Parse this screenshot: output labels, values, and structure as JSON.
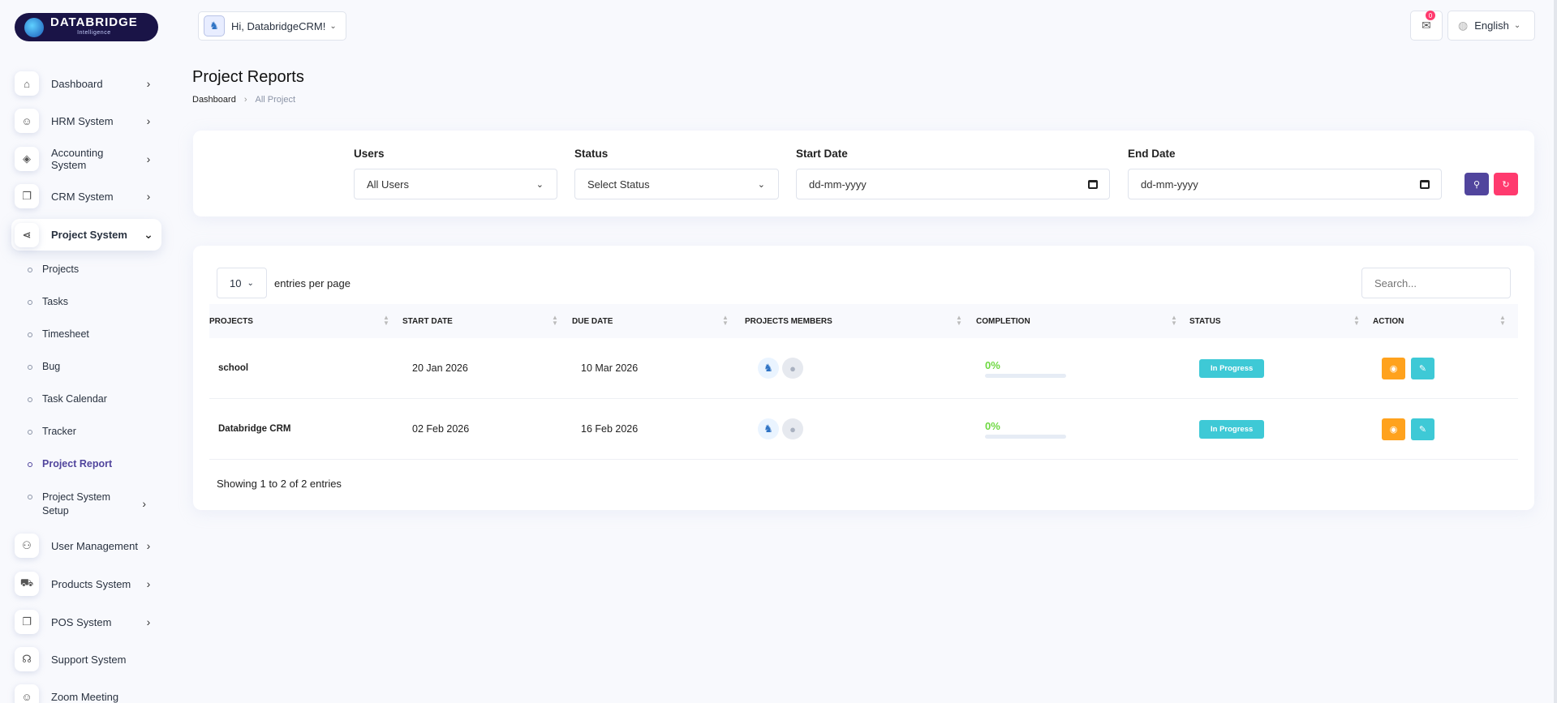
{
  "brand": {
    "logo_text": "DATABRIDGE",
    "logo_sub": "Intelligence"
  },
  "sidebar": {
    "items": [
      {
        "label": "Dashboard",
        "icon": "home-icon"
      },
      {
        "label": "HRM System",
        "icon": "user-icon"
      },
      {
        "label": "Accounting System",
        "icon": "box-icon"
      },
      {
        "label": "CRM System",
        "icon": "layers-icon"
      },
      {
        "label": "Project System",
        "icon": "share-icon"
      },
      {
        "label": "User Management",
        "icon": "users-icon"
      },
      {
        "label": "Products System",
        "icon": "cart-icon"
      },
      {
        "label": "POS System",
        "icon": "layers-icon"
      },
      {
        "label": "Support System",
        "icon": "headset-icon"
      },
      {
        "label": "Zoom Meeting",
        "icon": "user-video-icon"
      }
    ],
    "project_sub": [
      {
        "label": "Projects"
      },
      {
        "label": "Tasks"
      },
      {
        "label": "Timesheet"
      },
      {
        "label": "Bug"
      },
      {
        "label": "Task Calendar"
      },
      {
        "label": "Tracker"
      },
      {
        "label": "Project Report"
      },
      {
        "label": "Project System Setup"
      }
    ]
  },
  "header": {
    "greeting": "Hi, DatabridgeCRM!",
    "notification_count": "0",
    "language": "English"
  },
  "page": {
    "title": "Project Reports",
    "breadcrumb": [
      "Dashboard",
      "All Project"
    ]
  },
  "filters": {
    "users_label": "Users",
    "users_value": "All Users",
    "status_label": "Status",
    "status_value": "Select Status",
    "start_label": "Start Date",
    "start_placeholder": "dd-mm-yyyy",
    "end_label": "End Date",
    "end_placeholder": "dd-mm-yyyy"
  },
  "table": {
    "per_page": "10",
    "per_page_label": "entries per page",
    "search_placeholder": "Search...",
    "columns": [
      "Projects",
      "Start Date",
      "Due Date",
      "Projects Members",
      "Completion",
      "Status",
      "Action"
    ],
    "rows": [
      {
        "project": "school",
        "start": "20 Jan 2026",
        "due": "10 Mar 2026",
        "completion": "0%",
        "completion_value": 0,
        "status": "In Progress"
      },
      {
        "project": "Databridge CRM",
        "start": "02 Feb 2026",
        "due": "16 Feb 2026",
        "completion": "0%",
        "completion_value": 0,
        "status": "In Progress"
      }
    ],
    "footer": "Showing 1 to 2 of 2 entries"
  },
  "colors": {
    "primary": "#51459d",
    "danger": "#ff3a6e",
    "warning": "#ffa21d",
    "info": "#3ec9d6",
    "success": "#6fd943"
  }
}
